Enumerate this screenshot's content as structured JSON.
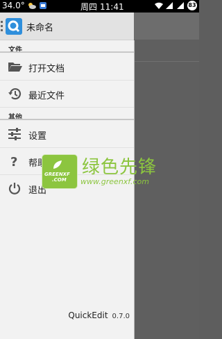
{
  "status_bar": {
    "temperature": "34.0°",
    "weekday": "周四",
    "time": "11:41",
    "battery": "83"
  },
  "app": {
    "title": "未命名",
    "name": "QuickEdit",
    "version": "0.7.0"
  },
  "drawer": {
    "sections": [
      {
        "header": "文件",
        "items": [
          {
            "label": "打开文档",
            "icon": "folder-open-icon"
          },
          {
            "label": "最近文件",
            "icon": "history-icon"
          }
        ]
      },
      {
        "header": "其他",
        "items": [
          {
            "label": "设置",
            "icon": "settings-sliders-icon"
          },
          {
            "label": "帮助",
            "icon": "help-question-icon"
          },
          {
            "label": "退出",
            "icon": "power-icon"
          }
        ]
      }
    ]
  },
  "watermark": {
    "logo_line1": "GREENXF",
    "logo_line2": ".COM",
    "brand": "绿色先锋",
    "url": "www.greenxf.com",
    "color": "#8cc53f"
  }
}
